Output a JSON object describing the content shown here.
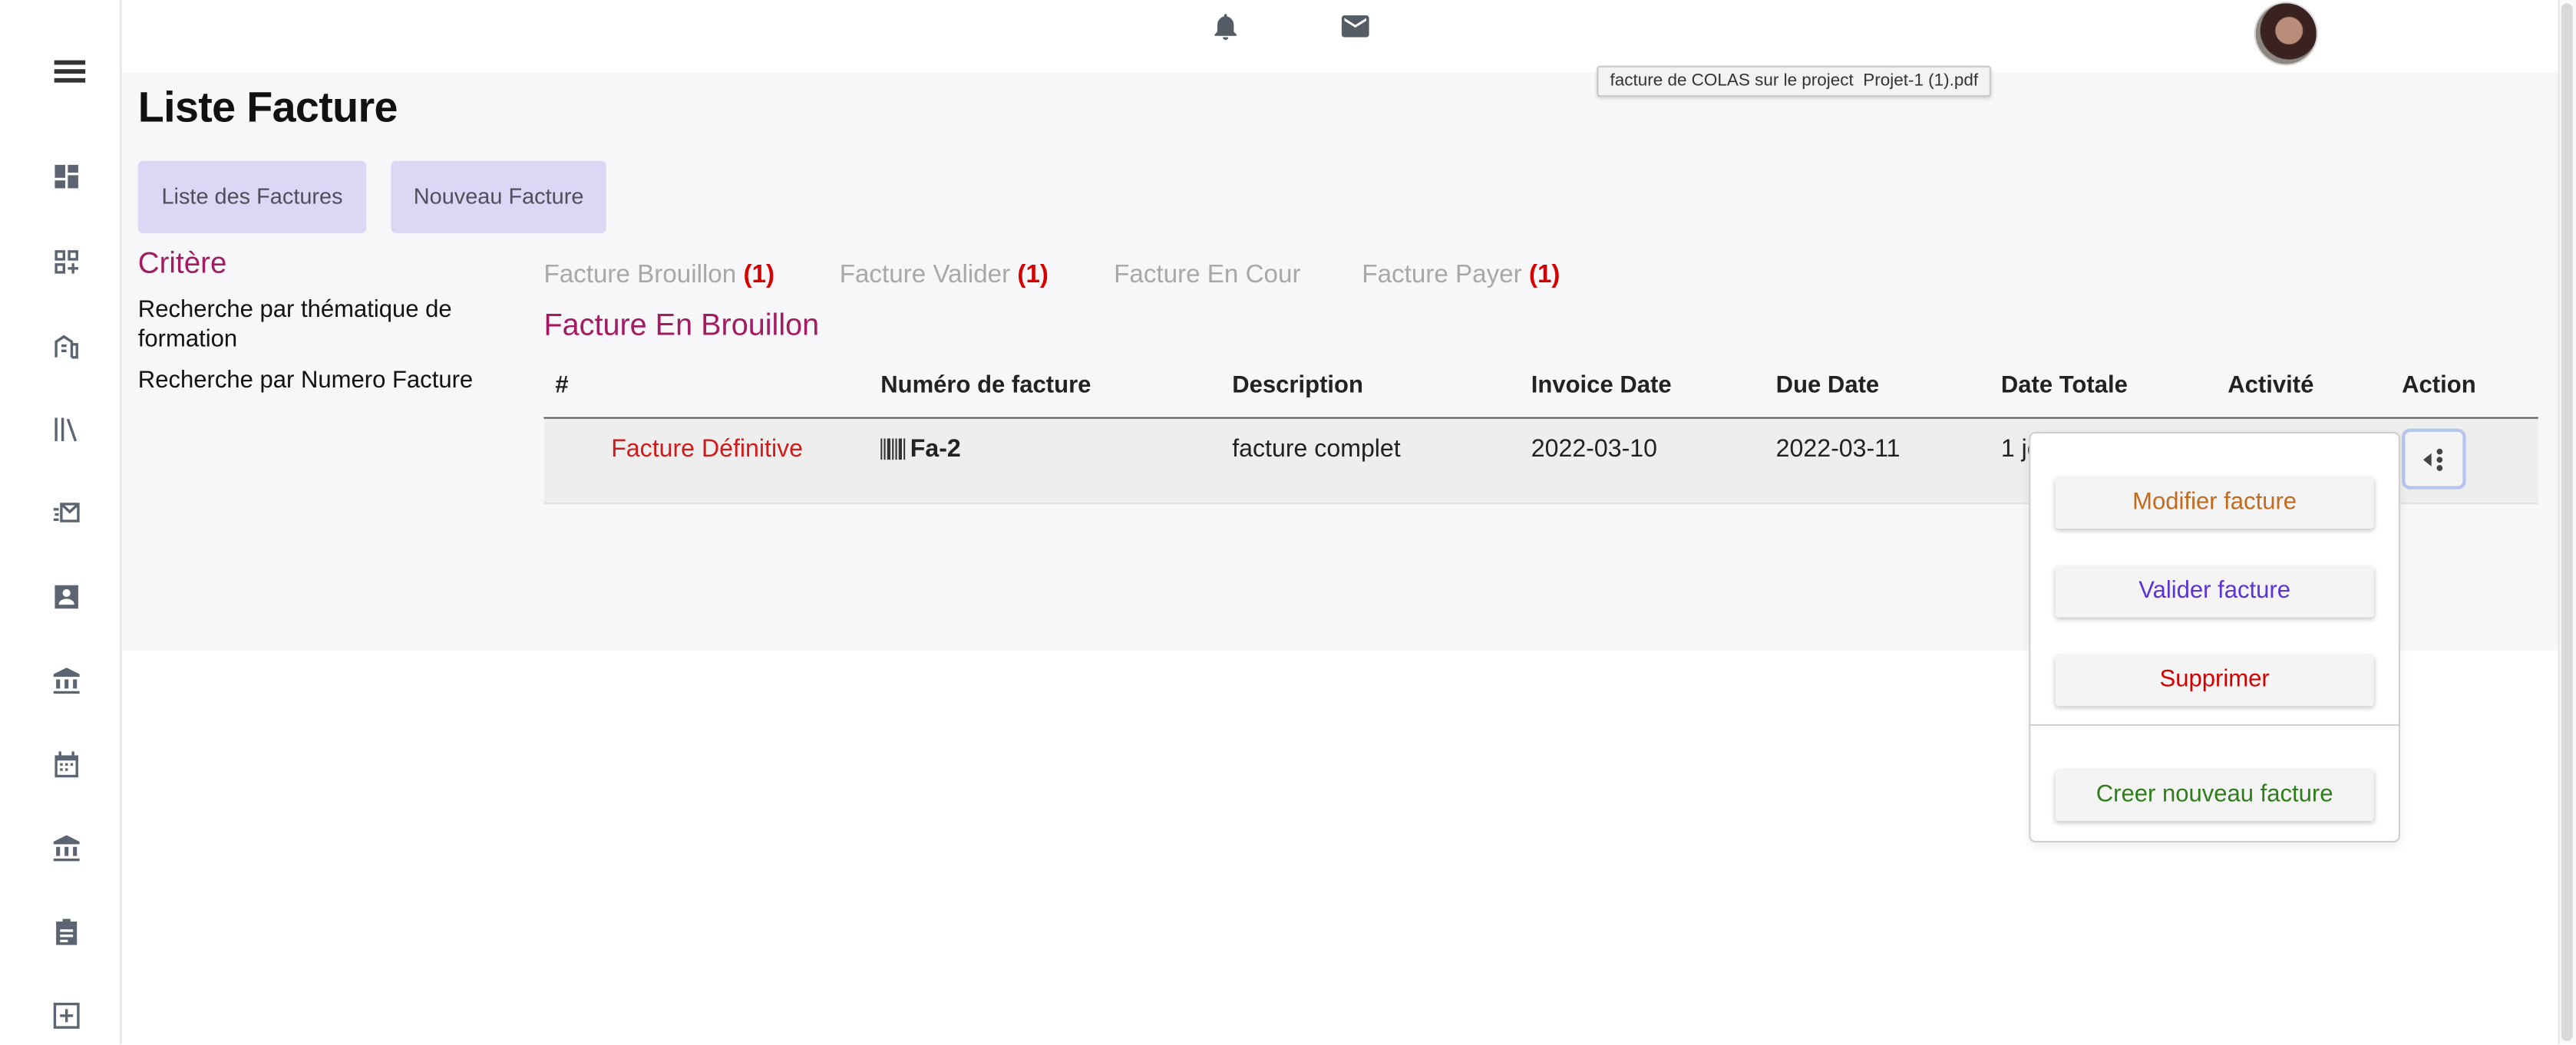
{
  "topbar": {
    "tooltip": "facture de COLAS sur le project  Projet-1 (1).pdf",
    "icons": [
      "bell-icon",
      "mail-icon"
    ]
  },
  "sidebar": {
    "icons": [
      "menu-icon",
      "dashboard-icon",
      "apps-add-icon",
      "building-icon",
      "library-icon",
      "mail-send-icon",
      "contact-icon",
      "bank-icon",
      "calendar-icon",
      "bank-icon-2",
      "event-note-icon",
      "add-box-icon"
    ]
  },
  "page": {
    "title": "Liste Facture",
    "buttons": {
      "list": "Liste des Factures",
      "new": "Nouveau Facture"
    }
  },
  "criteria": {
    "title": "Critère",
    "links": [
      "Recherche par thématique de formation",
      "Recherche par Numero Facture"
    ]
  },
  "status_tabs": [
    {
      "label": "Facture Brouillon",
      "count": "(1)"
    },
    {
      "label": "Facture Valider",
      "count": "(1)"
    },
    {
      "label": "Facture En Cour",
      "count": ""
    },
    {
      "label": "Facture Payer",
      "count": "(1)"
    }
  ],
  "section_title": "Facture En Brouillon",
  "table": {
    "headers": [
      "#",
      "Numéro de facture",
      "Description",
      "Invoice Date",
      "Due Date",
      "Date Totale",
      "Activité",
      "Action"
    ],
    "rows": [
      {
        "status": "Facture Définitive",
        "number": "Fa-2",
        "description": "facture complet",
        "invoice_date": "2022-03-10",
        "due_date": "2022-03-11",
        "total_date": "1 jo"
      }
    ]
  },
  "action_menu": {
    "items": [
      {
        "label": "Modifier facture",
        "color": "#c26a1d"
      },
      {
        "label": "Valider facture",
        "color": "#5a34d6"
      },
      {
        "label": "Supprimer",
        "color": "#d40000"
      },
      {
        "label": "Creer nouveau facture",
        "color": "#2f7d1a"
      }
    ]
  },
  "colors": {
    "accent": "#a21c63",
    "tab_button_bg": "#ddd6f4",
    "count_red": "#d40000"
  }
}
